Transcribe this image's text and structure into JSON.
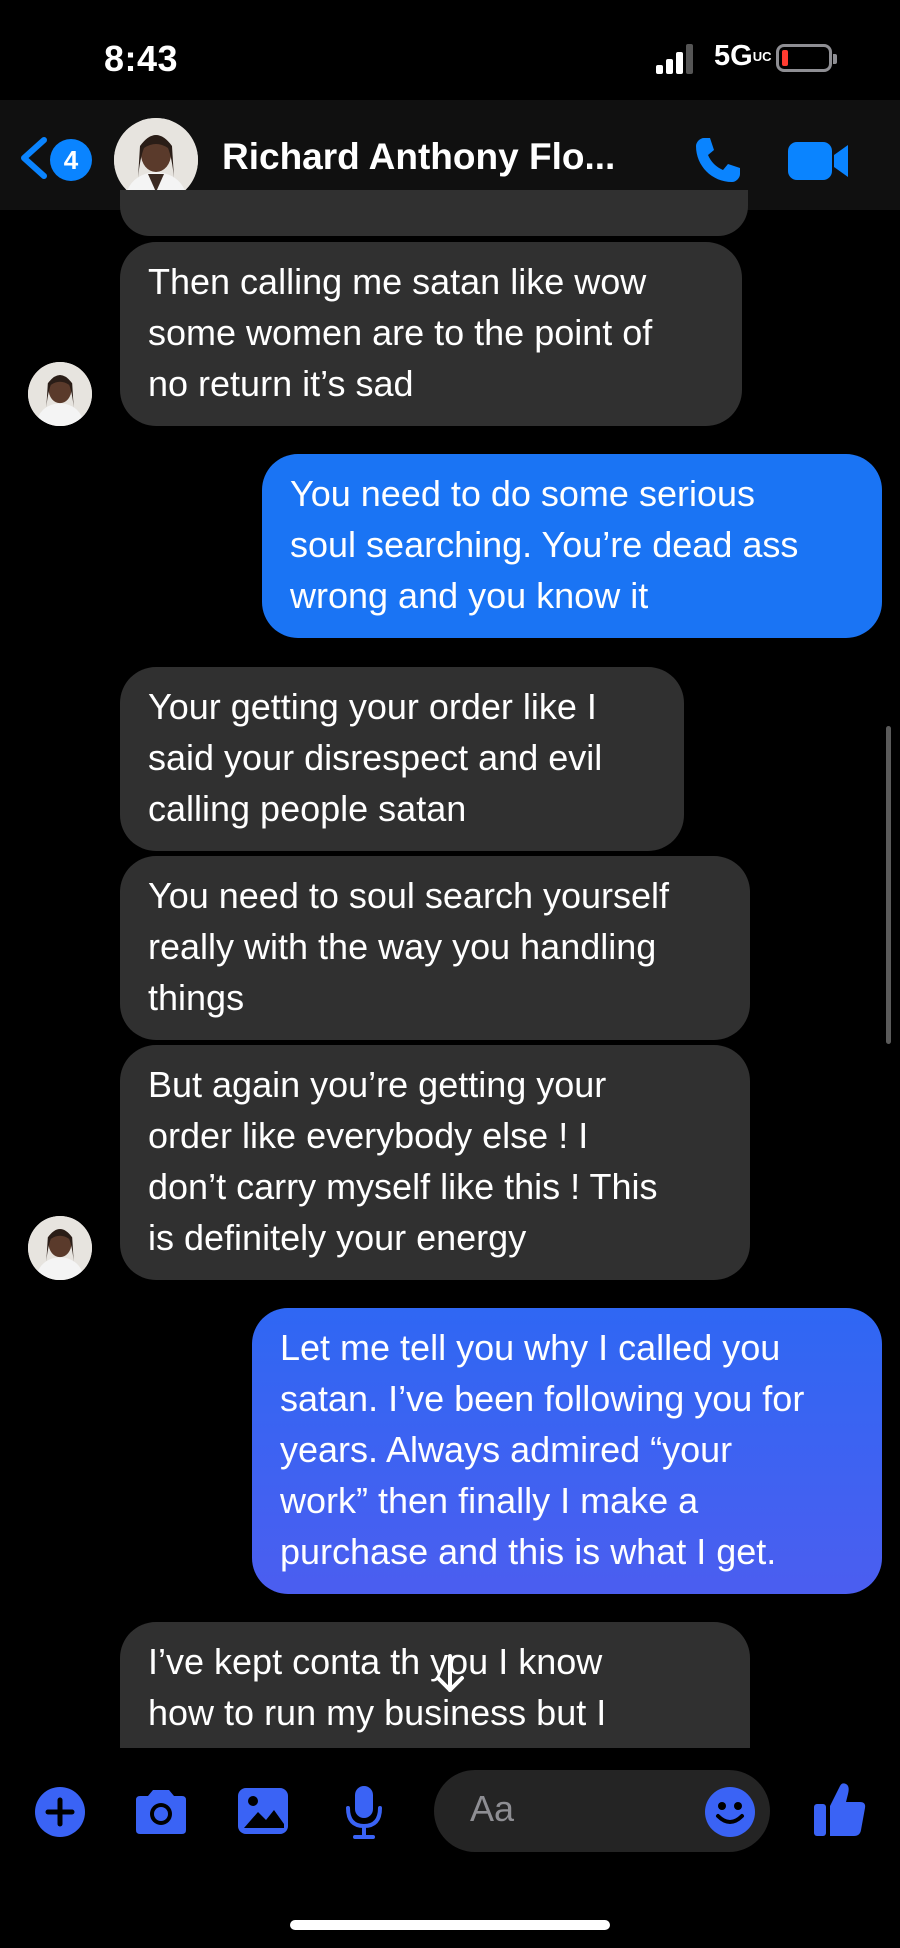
{
  "status_bar": {
    "time": "8:43",
    "network": "5G",
    "network_sub": "UC"
  },
  "header": {
    "back_count": "4",
    "title": "Richard Anthony Flo..."
  },
  "messages": [
    {
      "from": "them",
      "text": "Then calling me satan like wow\nsome women are to the point of\nno return it’s sad"
    },
    {
      "from": "me",
      "text": "You need to do some serious\nsoul searching. You’re dead ass\nwrong and you know it"
    },
    {
      "from": "them",
      "text": "Your getting your order like I\nsaid your disrespect and evil\ncalling people satan"
    },
    {
      "from": "them",
      "text": "You need to soul search yourself\nreally with the way you handling\nthings"
    },
    {
      "from": "them",
      "text": "But again you’re getting your\norder like everybody else ! I\ndon’t carry myself like this ! This\nis definitely your energy"
    },
    {
      "from": "me",
      "text": "Let me tell you why I called you\nsatan. I’ve been following you for\nyears. Always admired “your\nwork” then finally I make a\npurchase and this is what I get."
    },
    {
      "from": "them",
      "text": "I’ve kept conta     th you I know\nhow to run my business but I"
    }
  ],
  "composer": {
    "placeholder": "Aa"
  },
  "icons": {
    "back": "chevron-left-icon",
    "call": "phone-icon",
    "video": "video-camera-icon",
    "plus": "plus-circle-icon",
    "camera": "camera-icon",
    "gallery": "photo-gallery-icon",
    "mic": "microphone-icon",
    "emoji": "emoji-icon",
    "like": "thumbs-up-icon",
    "scroll": "arrow-down-icon"
  },
  "colors": {
    "accent": "#0a84ff",
    "incoming": "#303030",
    "outgoing_top": "#1a74f4",
    "outgoing_bottom": "#4a5cf0"
  }
}
